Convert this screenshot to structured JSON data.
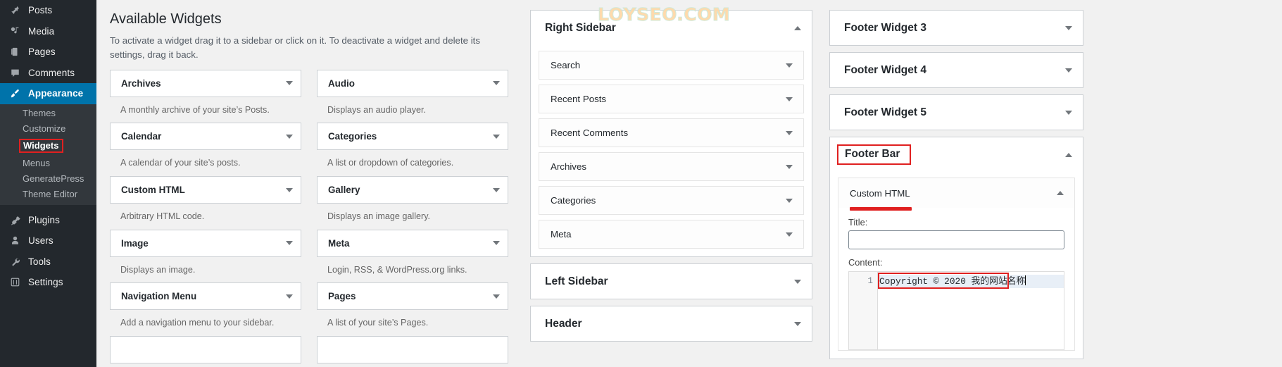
{
  "admin_menu": {
    "items": [
      {
        "label": "Posts",
        "icon": "pin-icon",
        "current": false
      },
      {
        "label": "Media",
        "icon": "media-icon",
        "current": false
      },
      {
        "label": "Pages",
        "icon": "page-icon",
        "current": false
      },
      {
        "label": "Comments",
        "icon": "comment-icon",
        "current": false
      },
      {
        "label": "Appearance",
        "icon": "brush-icon",
        "current": true
      }
    ],
    "submenu": [
      {
        "label": "Themes",
        "current": false
      },
      {
        "label": "Customize",
        "current": false
      },
      {
        "label": "Widgets",
        "current": true
      },
      {
        "label": "Menus",
        "current": false
      },
      {
        "label": "GeneratePress",
        "current": false
      },
      {
        "label": "Theme Editor",
        "current": false
      }
    ],
    "items_bottom": [
      {
        "label": "Plugins",
        "icon": "plug-icon"
      },
      {
        "label": "Users",
        "icon": "user-icon"
      },
      {
        "label": "Tools",
        "icon": "wrench-icon"
      },
      {
        "label": "Settings",
        "icon": "sliders-icon"
      }
    ]
  },
  "available": {
    "title": "Available Widgets",
    "description": "To activate a widget drag it to a sidebar or click on it. To deactivate a widget and delete its settings, drag it back.",
    "widgets": [
      {
        "name": "Archives",
        "desc": "A monthly archive of your site’s Posts."
      },
      {
        "name": "Audio",
        "desc": "Displays an audio player."
      },
      {
        "name": "Calendar",
        "desc": "A calendar of your site’s posts."
      },
      {
        "name": "Categories",
        "desc": "A list or dropdown of categories."
      },
      {
        "name": "Custom HTML",
        "desc": "Arbitrary HTML code."
      },
      {
        "name": "Gallery",
        "desc": "Displays an image gallery."
      },
      {
        "name": "Image",
        "desc": "Displays an image."
      },
      {
        "name": "Meta",
        "desc": "Login, RSS, & WordPress.org links."
      },
      {
        "name": "Navigation Menu",
        "desc": "Add a navigation menu to your sidebar."
      },
      {
        "name": "Pages",
        "desc": "A list of your site’s Pages."
      }
    ]
  },
  "sidebars_column": {
    "panels": [
      {
        "title": "Right Sidebar",
        "expanded": true,
        "widgets": [
          "Search",
          "Recent Posts",
          "Recent Comments",
          "Archives",
          "Categories",
          "Meta"
        ]
      },
      {
        "title": "Left Sidebar",
        "expanded": false,
        "widgets": []
      },
      {
        "title": "Header",
        "expanded": false,
        "widgets": []
      }
    ]
  },
  "footers_column": {
    "panels": [
      {
        "title": "Footer Widget 3",
        "expanded": false
      },
      {
        "title": "Footer Widget 4",
        "expanded": false
      },
      {
        "title": "Footer Widget 5",
        "expanded": false
      }
    ],
    "footer_bar": {
      "title": "Footer Bar",
      "expanded": true,
      "highlighted": true,
      "widget": {
        "name": "Custom HTML",
        "expanded": true,
        "underlined": true,
        "title_label": "Title:",
        "title_value": "",
        "title_placeholder": "",
        "content_label": "Content:",
        "line_number": "1",
        "content_value": "Copyright © 2020 我的网站名称"
      }
    }
  },
  "watermark": {
    "text": "LOYSEO.COM"
  },
  "colors": {
    "accent": "#0073aa",
    "admin_bg": "#23282d",
    "submenu_bg": "#32373c",
    "annotation_red": "#e02020",
    "page_bg": "#f1f1f1"
  }
}
